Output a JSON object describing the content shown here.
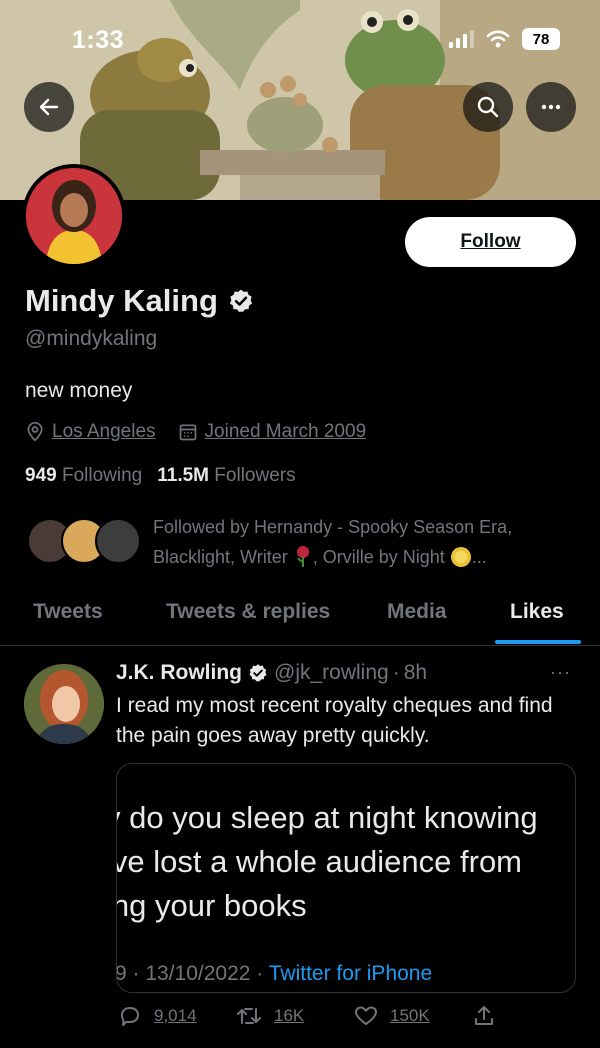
{
  "status_bar": {
    "time": "1:33",
    "battery": "78"
  },
  "profile": {
    "follow_label": "Follow",
    "name": "Mindy Kaling",
    "handle": "@mindykaling",
    "bio": "new money",
    "location": "Los Angeles",
    "joined": "Joined March 2009",
    "following_count": "949",
    "following_label": "Following",
    "followers_count": "11.5M",
    "followers_label": "Followers",
    "followed_by_line1": "Followed by Hernandy - Spooky Season Era,",
    "followed_by_line2_a": "Blacklight, Writer",
    "followed_by_line2_b": ", Orville by Night",
    "followed_by_ellipsis": "..."
  },
  "tabs": [
    {
      "label": "Tweets",
      "active": false
    },
    {
      "label": "Tweets & replies",
      "active": false
    },
    {
      "label": "Media",
      "active": false
    },
    {
      "label": "Likes",
      "active": true
    }
  ],
  "tweet": {
    "author_name": "J.K. Rowling",
    "author_handle": "@jk_rowling",
    "separator": "·",
    "time": "8h",
    "more": "···",
    "text": "I read my most recent royalty cheques and find the pain goes away pretty quickly.",
    "quote": {
      "line1": "v do you sleep at night knowing",
      "line2": "’ve lost a whole audience from",
      "line3": "ing your books",
      "meta_prefix": "9 · 13/10/2022 ·",
      "source": "Twitter for iPhone"
    },
    "replies": "9,014",
    "retweets": "16K",
    "likes": "150K"
  },
  "colors": {
    "accent": "#1d9bf0",
    "muted": "#71767b",
    "text": "#e7e9ea",
    "border": "#2f3336"
  }
}
